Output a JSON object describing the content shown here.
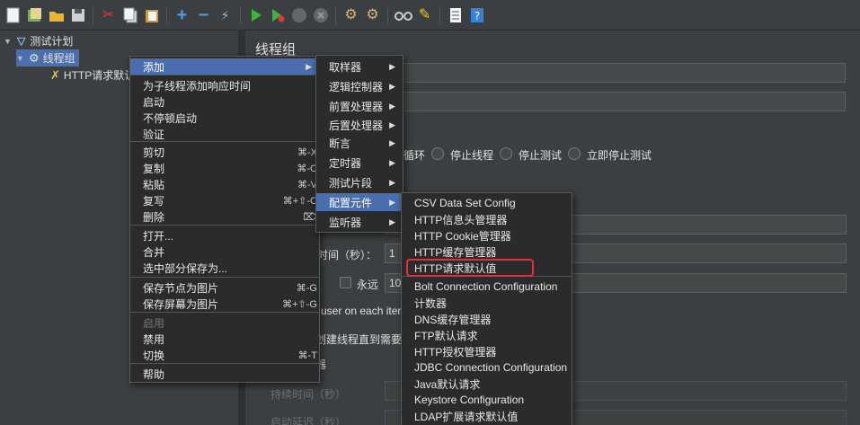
{
  "toolbar": {
    "icons": [
      "new-icon",
      "templates-icon",
      "open-icon",
      "save-icon",
      "cut-icon",
      "copy-icon",
      "paste-icon",
      "expand-icon",
      "collapse-icon",
      "toggle-icon",
      "start-icon",
      "start-no-pause-icon",
      "stop-icon",
      "shutdown-icon",
      "clear-icon",
      "clear-all-icon",
      "search-icon",
      "reset-search-icon",
      "function-helper-icon",
      "help-icon"
    ]
  },
  "tree": {
    "test_plan": "测试计划",
    "thread_group": "线程组",
    "http_defaults": "HTTP请求默认"
  },
  "right_panel": {
    "title": "线程组",
    "radio_loop": "循环",
    "radio_stop_thread": "停止线程",
    "radio_stop_test": "停止测试",
    "radio_stop_test_now": "立即停止测试",
    "ramp_label": "时间（秒）：",
    "ramp_value": "1",
    "forever_label": "永远",
    "loop_value": "10",
    "same_user": "user on each itera",
    "delay_create": "划建线程直到需要",
    "scheduler": "器",
    "duration": "持续时间（秒）",
    "startup_delay": "启动延迟（秒）"
  },
  "context_menu": {
    "items": [
      {
        "label": "添加",
        "arrow": "▶"
      },
      {
        "label": "为子线程添加响应时间"
      },
      {
        "label": "启动"
      },
      {
        "label": "不停顿启动"
      },
      {
        "label": "验证"
      },
      {
        "label": "剪切",
        "shortcut": "⌘-X"
      },
      {
        "label": "复制",
        "shortcut": "⌘-C"
      },
      {
        "label": "粘贴",
        "shortcut": "⌘-V"
      },
      {
        "label": "复写",
        "shortcut": "⌘+⇧-C"
      },
      {
        "label": "删除",
        "shortcut": "⌦"
      },
      {
        "label": "打开..."
      },
      {
        "label": "合并"
      },
      {
        "label": "选中部分保存为..."
      },
      {
        "label": "保存节点为图片",
        "shortcut": "⌘-G"
      },
      {
        "label": "保存屏幕为图片",
        "shortcut": "⌘+⇧-G"
      },
      {
        "label": "启用"
      },
      {
        "label": "禁用"
      },
      {
        "label": "切换",
        "shortcut": "⌘-T"
      },
      {
        "label": "帮助"
      }
    ]
  },
  "add_submenu": {
    "items": [
      "取样器",
      "逻辑控制器",
      "前置处理器",
      "后置处理器",
      "断言",
      "定时器",
      "测试片段",
      "配置元件",
      "监听器"
    ],
    "arrow": "▶"
  },
  "config_submenu": {
    "items": [
      "CSV Data Set Config",
      "HTTP信息头管理器",
      "HTTP Cookie管理器",
      "HTTP缓存管理器",
      "HTTP请求默认值",
      "Bolt Connection Configuration",
      "计数器",
      "DNS缓存管理器",
      "FTP默认请求",
      "HTTP授权管理器",
      "JDBC Connection Configuration",
      "Java默认请求",
      "Keystore Configuration",
      "LDAP扩展请求默认值"
    ]
  },
  "colors": {
    "background": "#3c3f41",
    "menu_bg": "#2b2b2b",
    "highlight": "#4b6eaf",
    "annotation": "#e0303a"
  }
}
